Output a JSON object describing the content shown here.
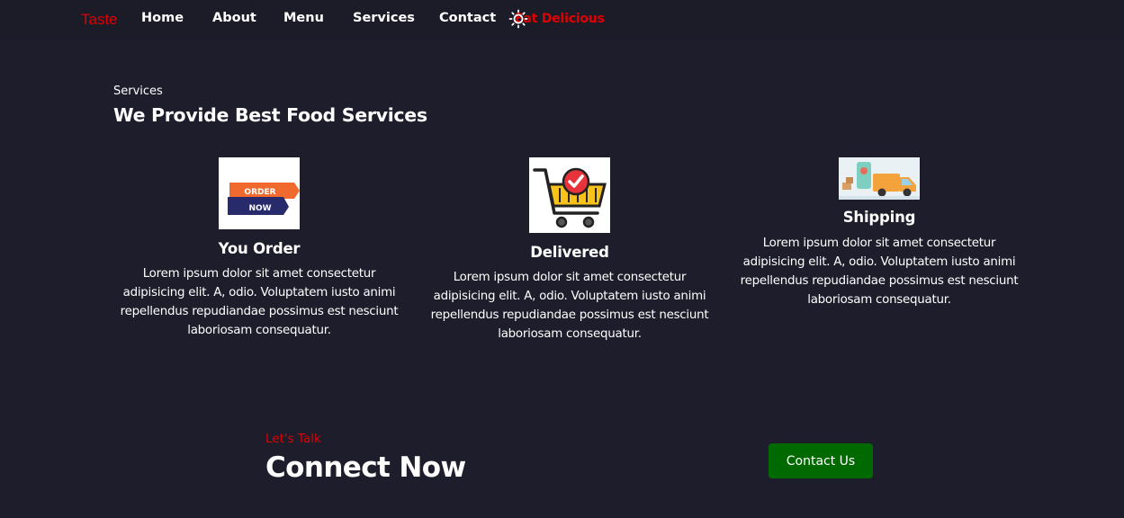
{
  "nav": {
    "logo": "Taste",
    "links": [
      "Home",
      "About",
      "Menu",
      "Services",
      "Contact"
    ],
    "tagline": "Eat Delicious",
    "theme_icon": "sun-icon"
  },
  "services": {
    "subtitle": "Services",
    "title": "We Provide Best Food Services",
    "cards": [
      {
        "image": "order-now-badge",
        "image_text_top": "ORDER",
        "image_text_bottom": "NOW",
        "title": "You Order",
        "text": "Lorem ipsum dolor sit amet consectetur adipisicing elit. A, odio. Voluptatem iusto animi repellendus repudiandae possimus est nesciunt laboriosam consequatur."
      },
      {
        "image": "shopping-cart-check",
        "title": "Delivered",
        "text": "Lorem ipsum dolor sit amet consectetur adipisicing elit. A, odio. Voluptatem iusto animi repellendus repudiandae possimus est nesciunt laboriosam consequatur."
      },
      {
        "image": "delivery-truck",
        "title": "Shipping",
        "text": "Lorem ipsum dolor sit amet consectetur adipisicing elit. A, odio. Voluptatem iusto animi repellendus repudiandae possimus est nesciunt laboriosam consequatur."
      }
    ]
  },
  "contact": {
    "eyebrow": "Let's Talk",
    "title": "Connect Now",
    "button": "Contact Us"
  },
  "colors": {
    "background": "#1e1d2b",
    "accent_red": "#e00000",
    "button_green": "#006a00"
  }
}
